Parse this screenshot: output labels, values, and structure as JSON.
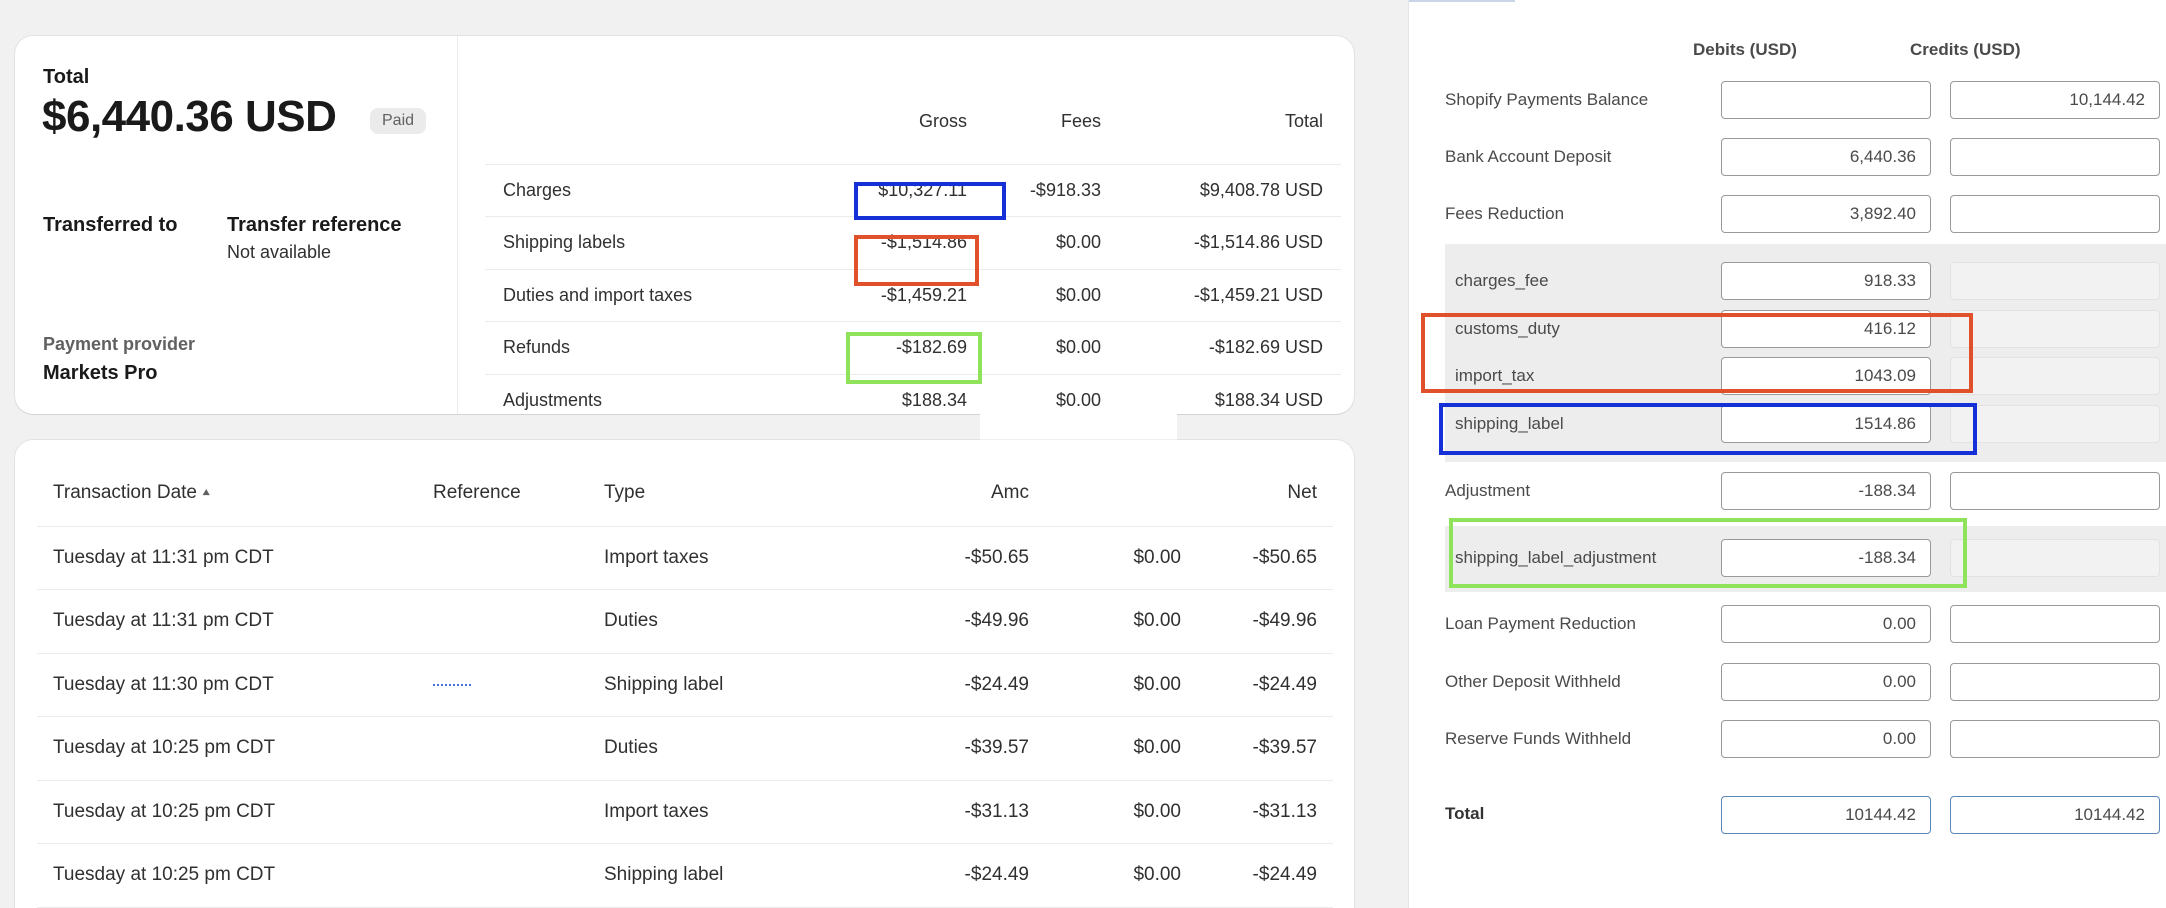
{
  "summary": {
    "total_label": "Total",
    "total_amount": "$6,440.36 USD",
    "status_badge": "Paid",
    "transferred_to_label": "Transferred to",
    "transfer_reference_label": "Transfer reference",
    "transfer_reference_value": "Not available",
    "payment_provider_label": "Payment provider",
    "payment_provider_value": "Markets Pro",
    "table": {
      "headers": [
        "",
        "Gross",
        "Fees",
        "Total"
      ],
      "rows": [
        {
          "label": "Charges",
          "gross": "$10,327.11",
          "fees": "-$918.33",
          "total": "$9,408.78 USD"
        },
        {
          "label": "Shipping labels",
          "gross": "-$1,514.86",
          "fees": "$0.00",
          "total": "-$1,514.86 USD"
        },
        {
          "label": "Duties and import taxes",
          "gross": "-$1,459.21",
          "fees": "$0.00",
          "total": "-$1,459.21 USD"
        },
        {
          "label": "Refunds",
          "gross": "-$182.69",
          "fees": "$0.00",
          "total": "-$182.69 USD"
        },
        {
          "label": "Adjustments",
          "gross": "$188.34",
          "fees": "$0.00",
          "total": "$188.34 USD"
        }
      ]
    }
  },
  "transactions": {
    "headers": {
      "date": "Transaction Date",
      "reference": "Reference",
      "type": "Type",
      "amount": "Amc",
      "net": "Net"
    },
    "rows": [
      {
        "date": "Tuesday at 11:31 pm CDT",
        "type": "Import taxes",
        "amount": "-$50.65",
        "fee": "$0.00",
        "net": "-$50.65"
      },
      {
        "date": "Tuesday at 11:31 pm CDT",
        "type": "Duties",
        "amount": "-$49.96",
        "fee": "$0.00",
        "net": "-$49.96"
      },
      {
        "date": "Tuesday at 11:30 pm CDT",
        "type": "Shipping label",
        "amount": "-$24.49",
        "fee": "$0.00",
        "net": "-$24.49"
      },
      {
        "date": "Tuesday at 10:25 pm CDT",
        "type": "Duties",
        "amount": "-$39.57",
        "fee": "$0.00",
        "net": "-$39.57"
      },
      {
        "date": "Tuesday at 10:25 pm CDT",
        "type": "Import taxes",
        "amount": "-$31.13",
        "fee": "$0.00",
        "net": "-$31.13"
      },
      {
        "date": "Tuesday at 10:25 pm CDT",
        "type": "Shipping label",
        "amount": "-$24.49",
        "fee": "$0.00",
        "net": "-$24.49"
      }
    ]
  },
  "journal": {
    "debits_header": "Debits (USD)",
    "credits_header": "Credits (USD)",
    "rows": {
      "shopify_balance": {
        "label": "Shopify Payments Balance",
        "debit": "",
        "credit": "10,144.42"
      },
      "bank_deposit": {
        "label": "Bank Account Deposit",
        "debit": "6,440.36",
        "credit": ""
      },
      "fees_reduction": {
        "label": "Fees Reduction",
        "debit": "3,892.40",
        "credit": ""
      },
      "charges_fee": {
        "label": "charges_fee",
        "debit": "918.33"
      },
      "customs_duty": {
        "label": "customs_duty",
        "debit": "416.12"
      },
      "import_tax": {
        "label": "import_tax",
        "debit": "1043.09"
      },
      "shipping_label": {
        "label": "shipping_label",
        "debit": "1514.86"
      },
      "adjustment": {
        "label": "Adjustment",
        "debit": "-188.34",
        "credit": ""
      },
      "shipping_label_adjustment": {
        "label": "shipping_label_adjustment",
        "debit": "-188.34"
      },
      "loan_payment": {
        "label": "Loan Payment Reduction",
        "debit": "0.00",
        "credit": ""
      },
      "other_deposit": {
        "label": "Other Deposit Withheld",
        "debit": "0.00",
        "credit": ""
      },
      "reserve_funds": {
        "label": "Reserve Funds Withheld",
        "debit": "0.00",
        "credit": ""
      }
    },
    "total": {
      "label": "Total",
      "debit": "10144.42",
      "credit": "10144.42"
    }
  },
  "colors": {
    "highlight_blue": "#1530d6",
    "highlight_red": "#e0502a",
    "highlight_green": "#8fe35a"
  }
}
